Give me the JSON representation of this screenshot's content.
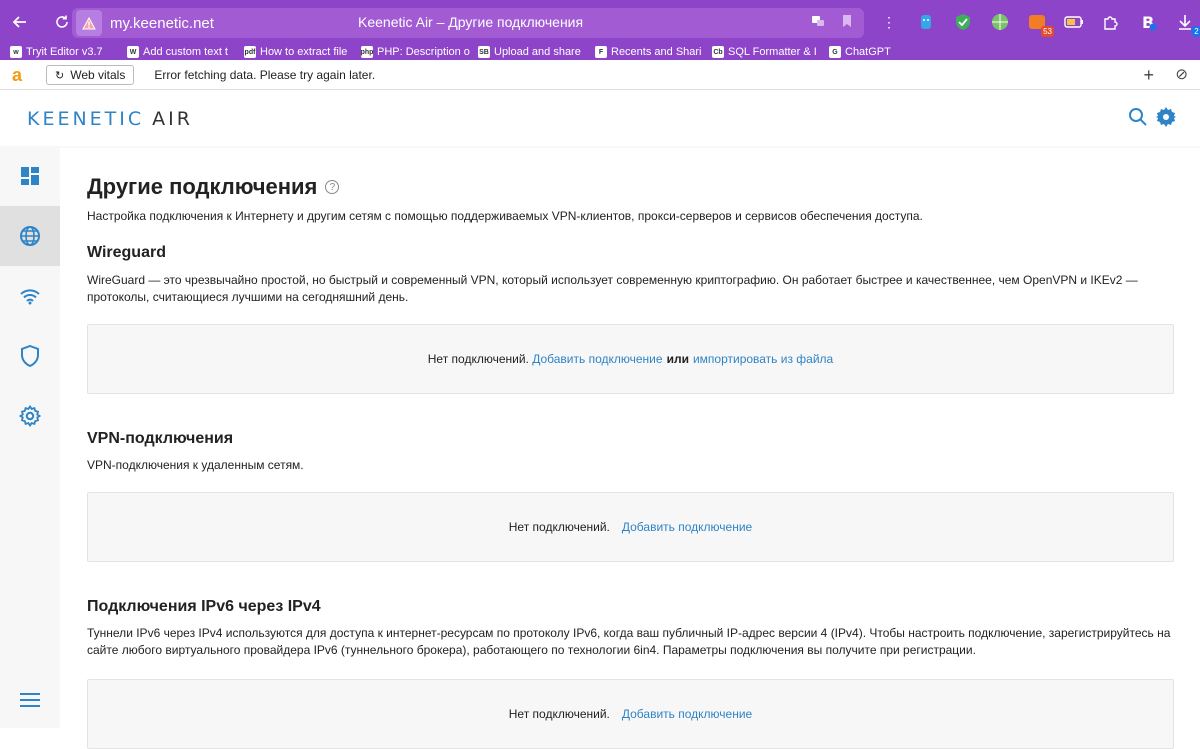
{
  "browser": {
    "url": "my.keenetic.net",
    "tab_title": "Keenetic Air – Другие подключения",
    "bookmarks": [
      {
        "label": "Tryit Editor v3.7",
        "fav": "w"
      },
      {
        "label": "Add custom text t",
        "fav": "W"
      },
      {
        "label": "How to extract file",
        "fav": "pdf"
      },
      {
        "label": "PHP: Description o",
        "fav": "php"
      },
      {
        "label": "Upload and share",
        "fav": "SB"
      },
      {
        "label": "Recents and Shari",
        "fav": "F"
      },
      {
        "label": "SQL Formatter & I",
        "fav": "Cb"
      },
      {
        "label": "ChatGPT",
        "fav": "G"
      }
    ],
    "extension_badges": {
      "orange": "53",
      "notify": "2"
    },
    "infobar": {
      "web_vitals_label": "Web vitals",
      "message": "Error fetching data. Please try again later."
    }
  },
  "header": {
    "logo_main": "KEENETIC",
    "logo_sub": "AIR"
  },
  "sidebar": {
    "items": [
      "dashboard-icon",
      "globe-icon",
      "wifi-icon",
      "shield-icon",
      "gear-icon"
    ],
    "active": 1
  },
  "page": {
    "title": "Другие подключения",
    "help": "?",
    "description": "Настройка подключения к Интернету и другим сетям с помощью поддерживаемых VPN-клиентов, прокси-серверов и сервисов обеспечения доступа."
  },
  "sections": {
    "wireguard": {
      "title": "Wireguard",
      "description": "WireGuard — это чрезвычайно простой, но быстрый и современный VPN, который использует современную криптографию. Он работает быстрее и качественнее, чем OpenVPN и IKEv2 — протоколы, считающиеся лучшими на сегодняшний день.",
      "empty_text": "Нет подключений.",
      "add_link": "Добавить подключение",
      "or_text": "или",
      "import_link": "импортировать из файла"
    },
    "vpn": {
      "title": "VPN-подключения",
      "description": "VPN-подключения к удаленным сетям.",
      "empty_text": "Нет подключений.",
      "add_link": "Добавить подключение"
    },
    "ipv6": {
      "title": "Подключения IPv6 через IPv4",
      "description": "Туннели IPv6 через IPv4 используются для доступа к интернет-ресурсам по протоколу IPv6, когда ваш публичный IP-адрес версии 4 (IPv4). Чтобы настроить подключение, зарегистрируйтесь на сайте любого виртуального провайдера IPv6 (туннельного брокера), работающего по технологии 6in4. Параметры подключения вы получите при регистрации.",
      "empty_text": "Нет подключений.",
      "add_link": "Добавить подключение"
    }
  }
}
